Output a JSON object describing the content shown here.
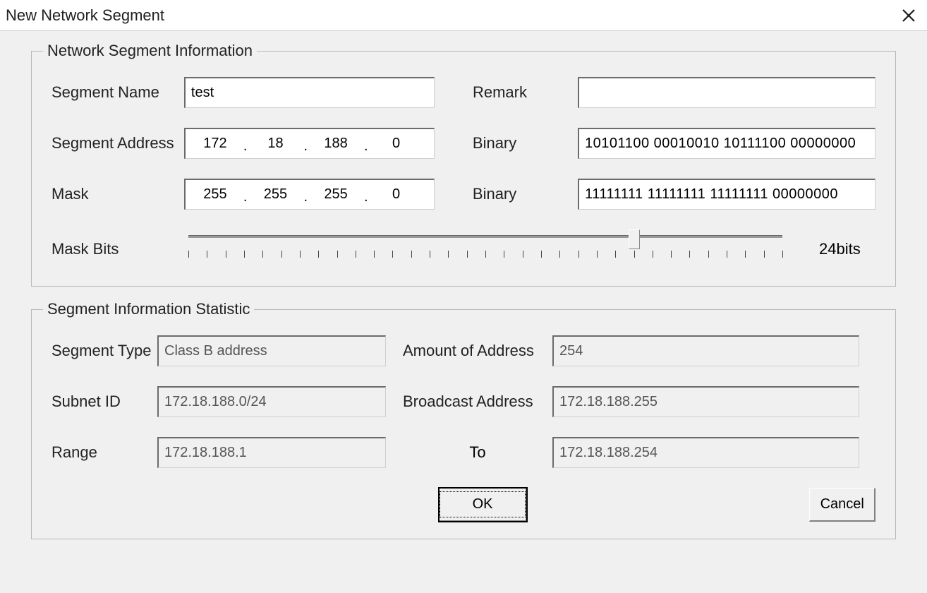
{
  "window": {
    "title": "New Network Segment"
  },
  "group1": {
    "legend": "Network Segment Information",
    "segmentNameLabel": "Segment Name",
    "segmentNameValue": "test",
    "remarkLabel": "Remark",
    "remarkValue": "",
    "segmentAddressLabel": "Segment Address",
    "addrOctets": {
      "o1": "172",
      "o2": "18",
      "o3": "188",
      "o4": "0"
    },
    "addrBinaryLabel": "Binary",
    "addrBinaryValue": "10101100 00010010 10111100 00000000",
    "maskLabel": "Mask",
    "maskOctets": {
      "o1": "255",
      "o2": "255",
      "o3": "255",
      "o4": "0"
    },
    "maskBinaryLabel": "Binary",
    "maskBinaryValue": "11111111 11111111 11111111 00000000",
    "maskBitsLabel": "Mask Bits",
    "maskBitsValue": "24bits",
    "maskBitsNumeric": 24,
    "maskBitsMax": 32
  },
  "group2": {
    "legend": "Segment Information Statistic",
    "segmentTypeLabel": "Segment Type",
    "segmentTypeValue": "Class B address",
    "amountLabel": "Amount of Address",
    "amountValue": "254",
    "subnetIdLabel": "Subnet ID",
    "subnetIdValue": "172.18.188.0/24",
    "broadcastLabel": "Broadcast Address",
    "broadcastValue": "172.18.188.255",
    "rangeLabel": "Range",
    "rangeFromValue": "172.18.188.1",
    "toLabel": "To",
    "rangeToValue": "172.18.188.254"
  },
  "buttons": {
    "ok": "OK",
    "cancel": "Cancel"
  }
}
